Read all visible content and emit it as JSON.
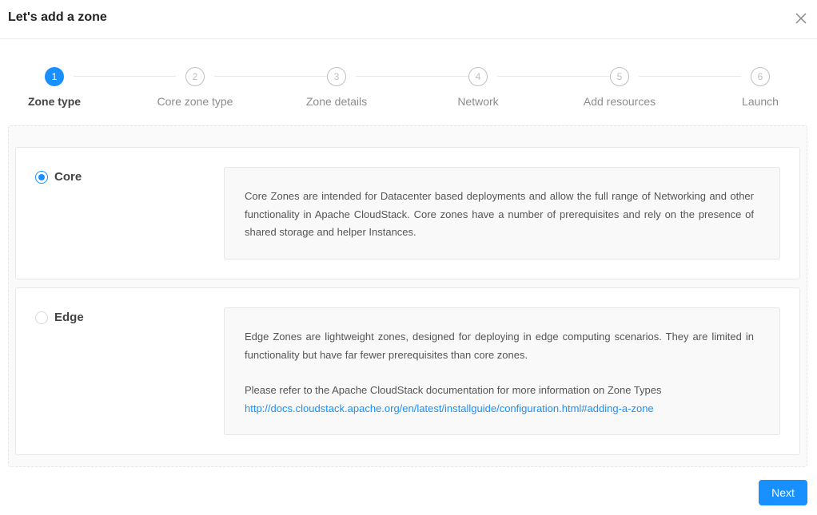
{
  "dialog": {
    "title": "Let's add a zone"
  },
  "steps": [
    {
      "number": "1",
      "label": "Zone type"
    },
    {
      "number": "2",
      "label": "Core zone type"
    },
    {
      "number": "3",
      "label": "Zone details"
    },
    {
      "number": "4",
      "label": "Network"
    },
    {
      "number": "5",
      "label": "Add resources"
    },
    {
      "number": "6",
      "label": "Launch"
    }
  ],
  "options": [
    {
      "label": "Core",
      "selected": true,
      "description": "Core Zones are intended for Datacenter based deployments and allow the full range of Networking and other functionality in Apache CloudStack. Core zones have a number of prerequisites and rely on the presence of shared storage and helper Instances."
    },
    {
      "label": "Edge",
      "selected": false,
      "description": "Edge Zones are lightweight zones, designed for deploying in edge computing scenarios. They are limited in functionality but have far fewer prerequisites than core zones.",
      "doc_text": "Please refer to the Apache CloudStack documentation for more information on Zone Types",
      "doc_link": "http://docs.cloudstack.apache.org/en/latest/installguide/configuration.html#adding-a-zone"
    }
  ],
  "footer": {
    "next_label": "Next"
  },
  "colors": {
    "accent": "#1890ff"
  }
}
